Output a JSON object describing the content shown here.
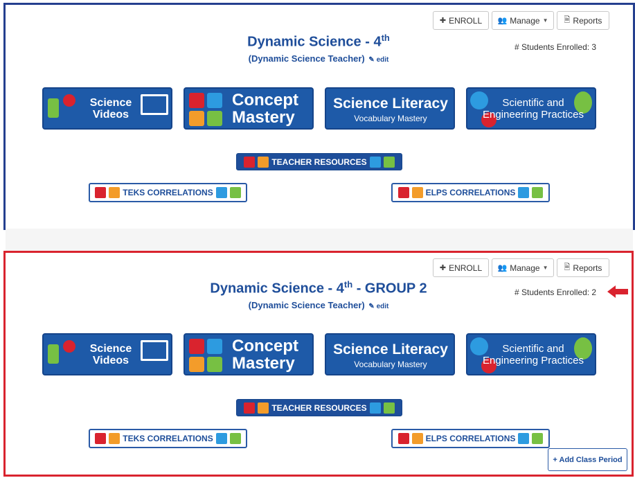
{
  "buttons": {
    "enroll": "ENROLL",
    "manage": "Manage",
    "reports": "Reports",
    "add_class_period": "+ Add Class Period"
  },
  "icons": {
    "plus": "plus-icon",
    "users": "users-icon",
    "document": "document-icon",
    "pencil": "pencil-icon",
    "caret": "caret-down-icon",
    "arrow": "left-arrow-icon"
  },
  "class1": {
    "title_prefix": "Dynamic Science - 4",
    "title_sup": "th",
    "title_suffix": "",
    "teacher": "(Dynamic Science Teacher)",
    "edit": "edit",
    "enrolled": "# Students Enrolled: 3"
  },
  "class2": {
    "title_prefix": "Dynamic Science - 4",
    "title_sup": "th",
    "title_suffix": " - GROUP 2",
    "teacher": "(Dynamic Science Teacher)",
    "edit": "edit",
    "enrolled": "# Students Enrolled: 2"
  },
  "tiles": {
    "science_videos": {
      "line1": "Science",
      "line2": "Videos"
    },
    "concept_mastery": {
      "line1": "Concept",
      "line2": "Mastery"
    },
    "science_literacy": {
      "line1": "Science Literacy",
      "line2": "Vocabulary Mastery"
    },
    "sep": {
      "line1": "Scientific and",
      "line2": "Engineering Practices"
    }
  },
  "resources": {
    "teacher": "TEACHER RESOURCES",
    "teks": "TEKS CORRELATIONS",
    "elps": "ELPS CORRELATIONS"
  },
  "colors": {
    "brand_blue": "#1f4e9a",
    "tile_blue": "#1e5aa8",
    "highlight_red": "#d9232e"
  }
}
